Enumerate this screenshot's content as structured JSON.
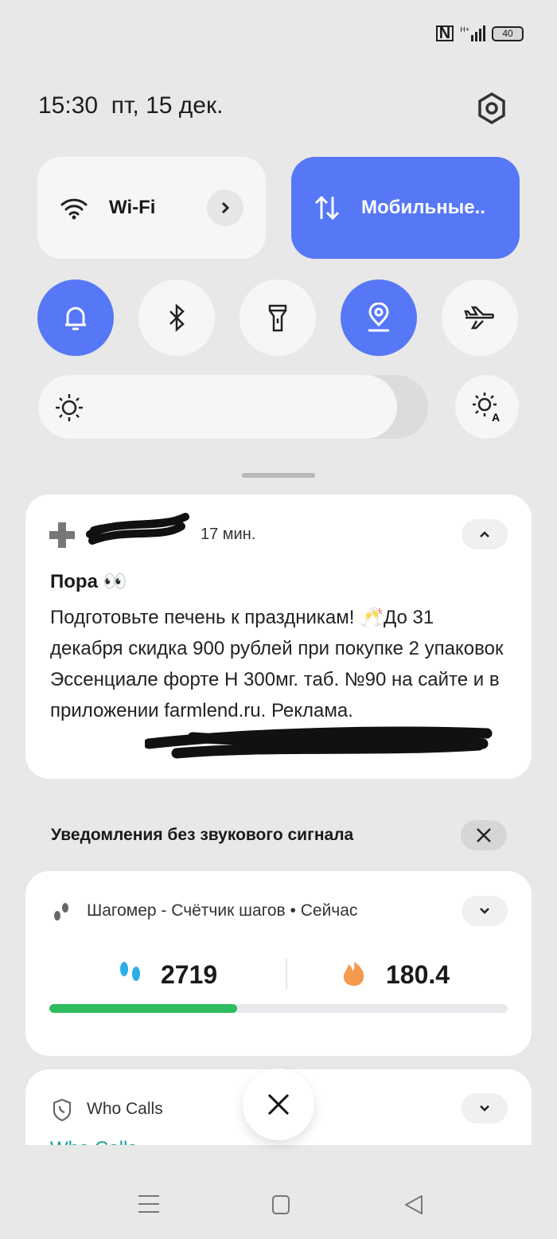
{
  "status": {
    "network": "H+",
    "battery": "40",
    "icons": [
      "nfc-icon",
      "signal-icon",
      "battery-icon"
    ]
  },
  "header": {
    "time": "15:30",
    "date": "пт, 15 дек."
  },
  "tiles": {
    "wifi": "Wi-Fi",
    "mobile": "Мобильные.."
  },
  "toggles": [
    {
      "icon": "bell-icon",
      "on": true
    },
    {
      "icon": "bluetooth-icon",
      "on": false
    },
    {
      "icon": "flashlight-icon",
      "on": false
    },
    {
      "icon": "location-icon",
      "on": true
    },
    {
      "icon": "airplane-icon",
      "on": false
    }
  ],
  "brightness": {
    "level_percent": 92
  },
  "colors": {
    "accent": "#5677f6",
    "progress": "#2dbd5e",
    "teal": "#1aa39a"
  },
  "notification1": {
    "time": "17 мин.",
    "title": "Пора 👀",
    "body": "Подготовьте печень к праздникам! 🥂До 31 декабря скидка 900 рублей при покупке 2 упаковок Эссенциале форте Н 300мг. таб. №90 на сайте и в приложении farmlend.ru.",
    "ad": "Реклама."
  },
  "silent": {
    "label": "Уведомления без звукового сигнала"
  },
  "pedometer": {
    "app": "Шагомер - Счётчик шагов",
    "time": "Сейчас",
    "steps": "2719",
    "calories": "180.4",
    "progress_percent": 41
  },
  "whocalls": {
    "app": "Who Calls",
    "preview": "Who Calls"
  }
}
